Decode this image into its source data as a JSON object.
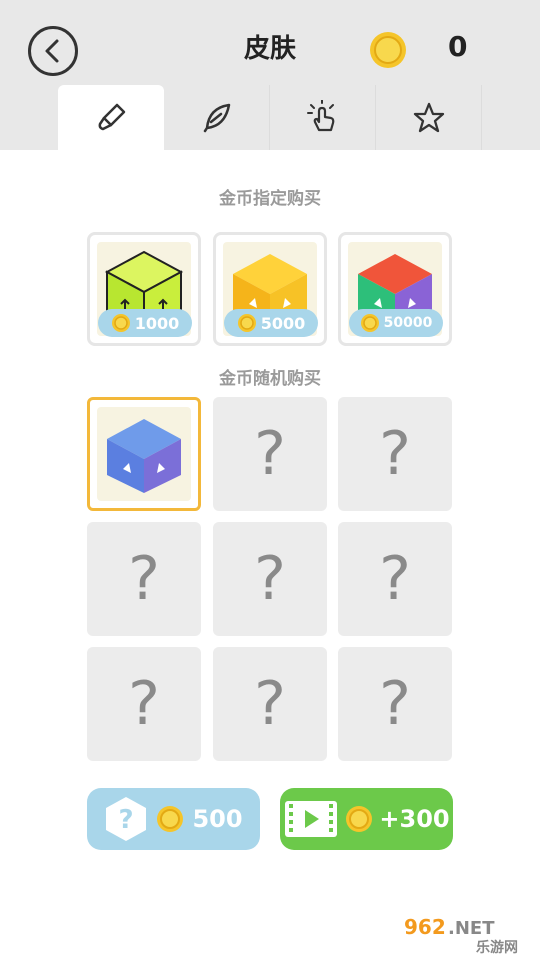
{
  "header": {
    "title": "皮肤",
    "coin_count": "0"
  },
  "tabs": [
    {
      "name": "brush",
      "icon": "paintbrush-icon",
      "active": true
    },
    {
      "name": "trail",
      "icon": "feather-icon",
      "active": false
    },
    {
      "name": "tap",
      "icon": "tap-hand-icon",
      "active": false
    },
    {
      "name": "star",
      "icon": "star-icon",
      "active": false
    }
  ],
  "sections": {
    "fixed_title": "金币指定购买",
    "random_title": "金币随机购买"
  },
  "fixed_items": [
    {
      "price": "1000",
      "skin": "lime-cube"
    },
    {
      "price": "5000",
      "skin": "yellow-cube"
    },
    {
      "price": "50000",
      "skin": "rainbow-cube"
    }
  ],
  "random_items": [
    {
      "state": "owned",
      "skin": "blue-cube"
    },
    {
      "state": "locked",
      "symbol": "?"
    },
    {
      "state": "locked",
      "symbol": "?"
    },
    {
      "state": "locked",
      "symbol": "?"
    },
    {
      "state": "locked",
      "symbol": "?"
    },
    {
      "state": "locked",
      "symbol": "?"
    },
    {
      "state": "locked",
      "symbol": "?"
    },
    {
      "state": "locked",
      "symbol": "?"
    },
    {
      "state": "locked",
      "symbol": "?"
    }
  ],
  "actions": {
    "random_buy_price": "500",
    "video_reward": "+300"
  },
  "watermark": {
    "site": "962.NET",
    "name": "乐游网"
  },
  "colors": {
    "accent_blue": "#a9d6ea",
    "accent_green": "#6cc94a",
    "selected_border": "#f3b83a",
    "coin": "#f5c52a"
  }
}
